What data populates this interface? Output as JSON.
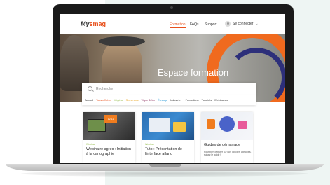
{
  "nav": {
    "logo_prefix": "My",
    "logo_brand": "smag",
    "links": [
      "Formation",
      "FAQs",
      "Support"
    ],
    "login_label": "Se connecter",
    "login_caret": "⌄"
  },
  "hero": {
    "title": "Espace formation"
  },
  "search": {
    "placeholder": "Recherche"
  },
  "filters": {
    "items": [
      {
        "label": "Accueil",
        "color": "#333333"
      },
      {
        "label": "Tous afficher",
        "color": "#e8501b"
      },
      {
        "label": "Végétal",
        "color": "#8cb63c"
      },
      {
        "label": "Semences",
        "color": "#e7a21c"
      },
      {
        "label": "Vigne & Vin",
        "color": "#8a2a5a"
      },
      {
        "label": "Élevage",
        "color": "#2d9bd6"
      },
      {
        "label": "Industrie",
        "color": "#333333"
      }
    ],
    "secondary": [
      "Formations",
      "Tutoriels",
      "Webinaires"
    ]
  },
  "cards": [
    {
      "tag": "Webinar",
      "title": "Webinaire agreo : Initiation à la cartographie",
      "badge": "12.11"
    },
    {
      "tag": "Webinar",
      "title": "Tuto : Présentation de l'interface atland"
    },
    {
      "title": "Guides de démarrage",
      "desc": "Pour bien débuter sur nos logiciels agricoles, suivez le guide !"
    }
  ],
  "colors": {
    "accent": "#e8501b",
    "hero_orange": "#f06a1e",
    "hero_navy": "#2d2f7a"
  }
}
